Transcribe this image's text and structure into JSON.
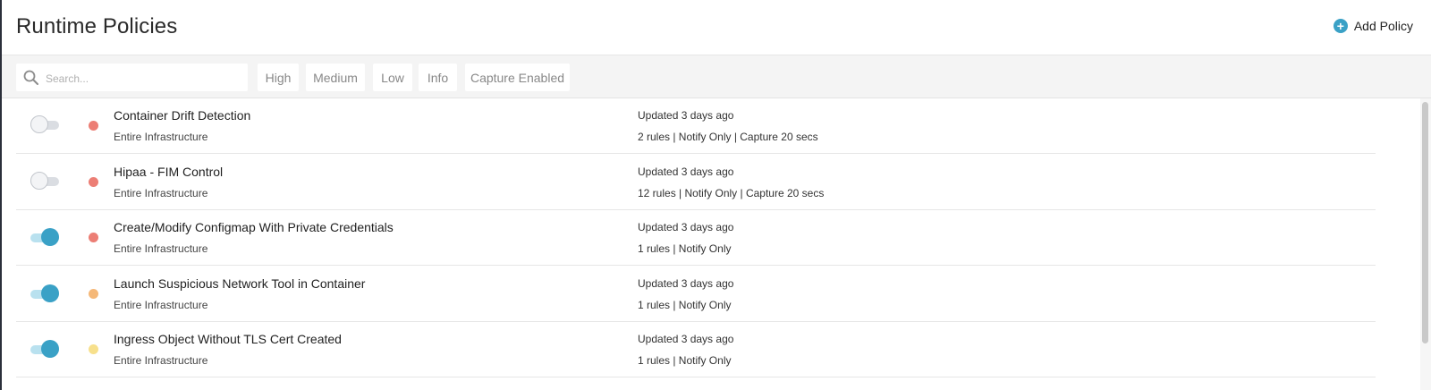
{
  "header": {
    "title": "Runtime Policies",
    "add_label": "Add Policy",
    "add_icon": "plus-circle-icon",
    "accent": "#3aa1c6"
  },
  "filters": {
    "search_placeholder": "Search...",
    "chips": [
      "High",
      "Medium",
      "Low",
      "Info",
      "Capture Enabled"
    ]
  },
  "severity_colors": {
    "high": "#ec7e75",
    "medium": "#f5b878",
    "low": "#f7e08c"
  },
  "policies": [
    {
      "enabled": false,
      "severity": "high",
      "name": "Container Drift Detection",
      "scope": "Entire Infrastructure",
      "updated": "Updated 3 days ago",
      "details": "2 rules | Notify Only | Capture 20 secs"
    },
    {
      "enabled": false,
      "severity": "high",
      "name": "Hipaa - FIM Control",
      "scope": "Entire Infrastructure",
      "updated": "Updated 3 days ago",
      "details": "12 rules | Notify Only | Capture 20 secs"
    },
    {
      "enabled": true,
      "severity": "high",
      "name": "Create/Modify Configmap With Private Credentials",
      "scope": "Entire Infrastructure",
      "updated": "Updated 3 days ago",
      "details": "1 rules | Notify Only"
    },
    {
      "enabled": true,
      "severity": "medium",
      "name": "Launch Suspicious Network Tool in Container",
      "scope": "Entire Infrastructure",
      "updated": "Updated 3 days ago",
      "details": "1 rules | Notify Only"
    },
    {
      "enabled": true,
      "severity": "low",
      "name": "Ingress Object Without TLS Cert Created",
      "scope": "Entire Infrastructure",
      "updated": "Updated 3 days ago",
      "details": "1 rules | Notify Only"
    }
  ]
}
